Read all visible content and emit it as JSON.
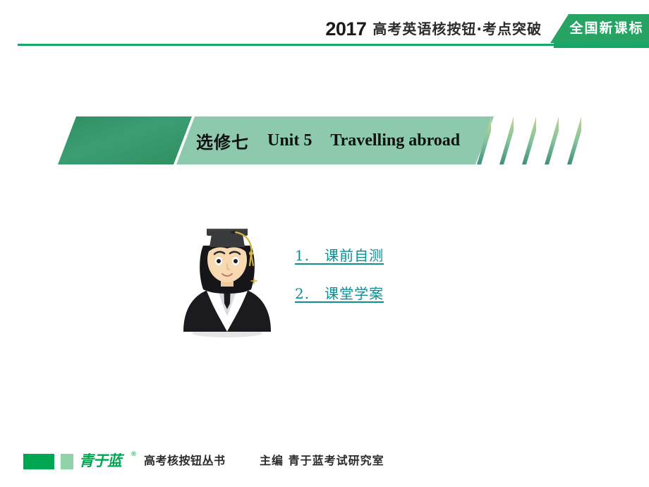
{
  "header": {
    "year": "2017",
    "subtitle": "高考英语核按钮·考点突破",
    "tag": "全国新课标",
    "accent_color": "#17a768",
    "tag_color": "#27a464"
  },
  "banner": {
    "book_label": "选修七",
    "unit_label": "Unit 5",
    "topic_label": "Travelling abroad",
    "dark_color": "#2f8f63",
    "light_color": "#8cc9ad"
  },
  "avatar": {
    "name": "graduate-student-illustration",
    "cap_color": "#3a3a3c",
    "tassel_color": "#d6b33c",
    "hair_color": "#15151a",
    "skin_color": "#f6d9b0",
    "gown_color": "#1b1b1f",
    "collar_color": "#ffffff"
  },
  "menu": {
    "items": [
      {
        "label": "1.　课前自测"
      },
      {
        "label": "2.　课堂学案"
      }
    ],
    "link_color": "#0b8f93"
  },
  "footer": {
    "logo_text": "青于蓝",
    "registered_mark": "®",
    "series": "高考核按钮丛书",
    "editor": "主编 青于蓝考试研究室",
    "block_color": "#00a651",
    "block_light_color": "#8fd4a8"
  }
}
